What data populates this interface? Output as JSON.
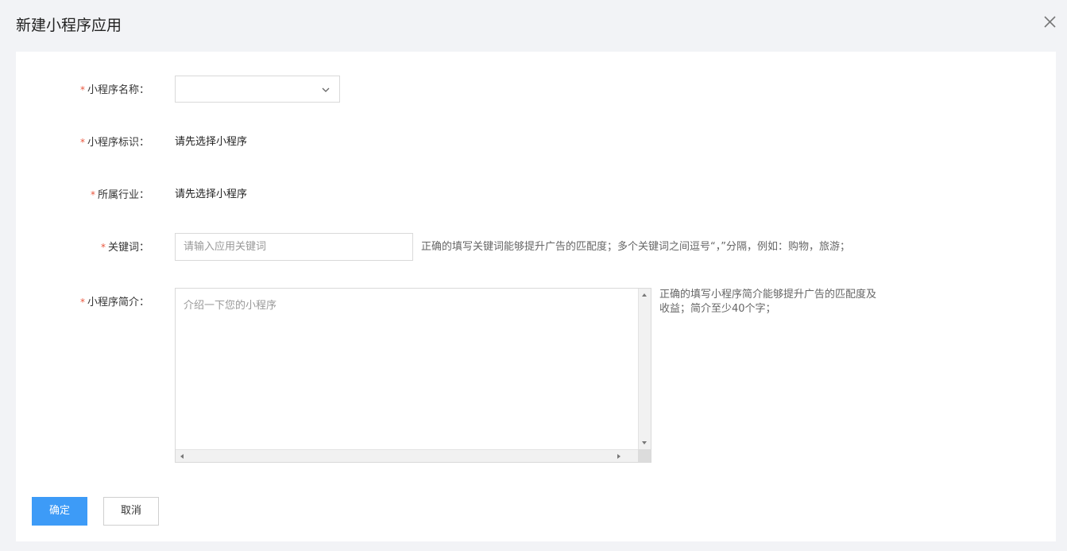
{
  "dialog": {
    "title": "新建小程序应用",
    "close_icon": "close-icon"
  },
  "form": {
    "required_mark": "*",
    "name": {
      "label": "小程序名称：",
      "selected_value": ""
    },
    "identifier": {
      "label": "小程序标识：",
      "value": "请先选择小程序"
    },
    "industry": {
      "label": "所属行业：",
      "value": "请先选择小程序"
    },
    "keywords": {
      "label": "关键词：",
      "placeholder": "请输入应用关键词",
      "hint": "正确的填写关键词能够提升广告的匹配度；多个关键词之间逗号“，”分隔，例如：购物，旅游；"
    },
    "intro": {
      "label": "小程序简介：",
      "placeholder": "介绍一下您的小程序",
      "hint_line1": "正确的填写小程序简介能够提升广告的匹配度及",
      "hint_line2": "收益；简介至少40个字；"
    }
  },
  "buttons": {
    "confirm": "确定",
    "cancel": "取消"
  },
  "colors": {
    "primary": "#3d9bf7",
    "required": "#e9573f",
    "page_bg": "#f2f3f6"
  }
}
